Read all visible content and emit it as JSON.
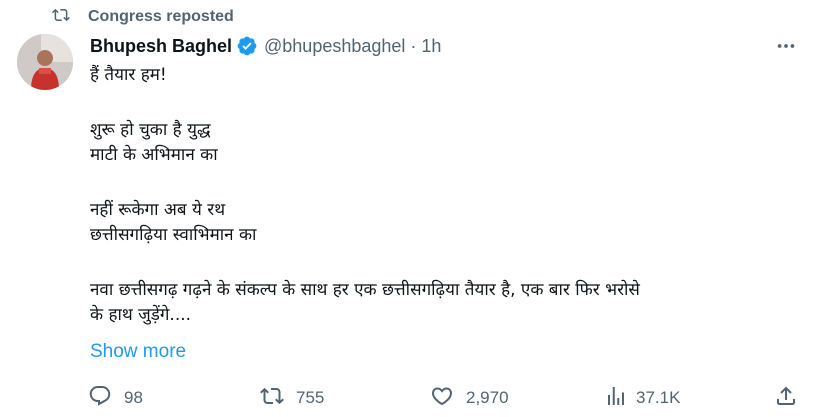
{
  "repost": {
    "label": "Congress reposted"
  },
  "author": {
    "name": "Bhupesh Baghel",
    "handle": "@bhupeshbaghel",
    "separator": "·",
    "time": "1h"
  },
  "tweet": {
    "lines": [
      "हैं तैयार हम!",
      "",
      "शुरू हो चुका है युद्ध",
      "माटी के अभिमान का",
      "",
      "नहीं रूकेगा अब ये रथ",
      "छत्तीसगढ़िया स्वाभिमान का",
      "",
      "नवा छत्तीसगढ़ गढ़ने के संकल्प के साथ हर एक छत्तीसगढ़िया तैयार है, एक बार फिर भरोसे",
      "के हाथ जुड़ेंगे...."
    ],
    "show_more": "Show more"
  },
  "actions": {
    "replies": "98",
    "reposts": "755",
    "likes": "2,970",
    "views": "37.1K"
  },
  "colors": {
    "accent": "#1d9bf0",
    "muted": "#536471",
    "text": "#0f1419",
    "avatar_shirt": "#c8322c"
  }
}
